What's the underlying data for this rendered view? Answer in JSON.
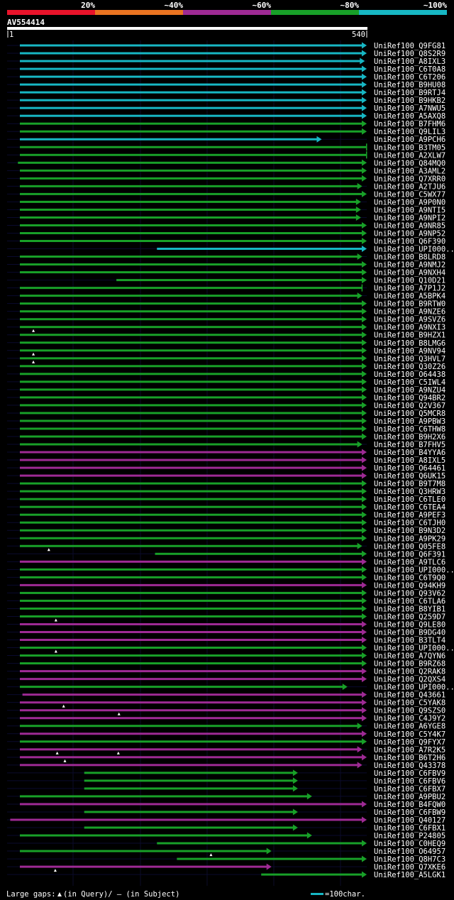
{
  "legend": {
    "p20": "20%",
    "p40": "~40%",
    "p60": "~60%",
    "p80": "~80%",
    "p100": "~100%",
    "colors": [
      "#e8132a",
      "#ea7421",
      "#9e2a94",
      "#18a028",
      "#17b7c4"
    ]
  },
  "query": {
    "name": "AV554414",
    "start": "1",
    "end": "540"
  },
  "footer": {
    "gaps_label": "Large gaps: ",
    "in_query": "(in Query)/",
    "dash": "—",
    "in_subject": " (in Subject)",
    "scale_label": "=100char."
  },
  "chart_data": {
    "type": "alignment",
    "query_length": 540,
    "color_map": {
      "c": "#17b7c4",
      "g": "#18a028",
      "m": "#9e2a94"
    },
    "hits": [
      {
        "name": "UniRef100_Q9FG81",
        "color": "c",
        "start": 1,
        "end": 540,
        "arrow": true
      },
      {
        "name": "UniRef100_Q8S2R9",
        "color": "c",
        "start": 1,
        "end": 540,
        "arrow": true
      },
      {
        "name": "UniRef100_A8IXL3",
        "color": "c",
        "start": 1,
        "end": 537,
        "arrow": true
      },
      {
        "name": "UniRef100_C6T0A8",
        "color": "c",
        "start": 1,
        "end": 540,
        "arrow": true
      },
      {
        "name": "UniRef100_C6T206",
        "color": "c",
        "start": 1,
        "end": 540,
        "arrow": true
      },
      {
        "name": "UniRef100_B9HU08",
        "color": "c",
        "start": 1,
        "end": 540,
        "arrow": true
      },
      {
        "name": "UniRef100_B9RTJ4",
        "color": "c",
        "start": 1,
        "end": 540,
        "arrow": true
      },
      {
        "name": "UniRef100_B9HKB2",
        "color": "c",
        "start": 1,
        "end": 540,
        "arrow": true
      },
      {
        "name": "UniRef100_A7NWU5",
        "color": "c",
        "start": 1,
        "end": 540,
        "arrow": true
      },
      {
        "name": "UniRef100_A5AXQ8",
        "color": "c",
        "start": 1,
        "end": 540,
        "arrow": true
      },
      {
        "name": "UniRef100_B7FHM6",
        "color": "g",
        "start": 1,
        "end": 540,
        "arrow": true
      },
      {
        "name": "UniRef100_Q9LIL3",
        "color": "g",
        "start": 1,
        "end": 540,
        "arrow": true
      },
      {
        "name": "UniRef100_A9PCH6",
        "color": "c",
        "start": 1,
        "end": 470,
        "arrow": true
      },
      {
        "name": "UniRef100_B3TM05",
        "color": "g",
        "start": 1,
        "end": 540,
        "arrow": false
      },
      {
        "name": "UniRef100_A2XLW7",
        "color": "g",
        "start": 1,
        "end": 540,
        "arrow": false
      },
      {
        "name": "UniRef100_Q84MQ0",
        "color": "g",
        "start": -2,
        "end": 540,
        "arrow": true
      },
      {
        "name": "UniRef100_A3AML2",
        "color": "g",
        "start": 1,
        "end": 540,
        "arrow": true
      },
      {
        "name": "UniRef100_Q7XRR0",
        "color": "g",
        "start": 1,
        "end": 540,
        "arrow": true
      },
      {
        "name": "UniRef100_A2TJU6",
        "color": "g",
        "start": 1,
        "end": 533,
        "arrow": true
      },
      {
        "name": "UniRef100_C5WX77",
        "color": "g",
        "start": 1,
        "end": 540,
        "arrow": true
      },
      {
        "name": "UniRef100_A9P0N0",
        "color": "g",
        "start": 1,
        "end": 531,
        "arrow": true
      },
      {
        "name": "UniRef100_A9NTI5",
        "color": "g",
        "start": 1,
        "end": 531,
        "arrow": true
      },
      {
        "name": "UniRef100_A9NPI2",
        "color": "g",
        "start": 1,
        "end": 531,
        "arrow": true
      },
      {
        "name": "UniRef100_A9NR85",
        "color": "g",
        "start": 1,
        "end": 540,
        "arrow": true
      },
      {
        "name": "UniRef100_A9NP52",
        "color": "g",
        "start": 1,
        "end": 540,
        "arrow": true
      },
      {
        "name": "UniRef100_Q6F390",
        "color": "g",
        "start": 1,
        "end": 540,
        "arrow": true
      },
      {
        "name": "UniRef100_UPI000..",
        "color": "c",
        "start": 214,
        "end": 540,
        "arrow": true
      },
      {
        "name": "UniRef100_B8LRD8",
        "color": "g",
        "start": 1,
        "end": 533,
        "arrow": true
      },
      {
        "name": "UniRef100_A9NMJ2",
        "color": "g",
        "start": 1,
        "end": 540,
        "arrow": true
      },
      {
        "name": "UniRef100_A9NXH4",
        "color": "g",
        "start": 1,
        "end": 540,
        "arrow": true
      },
      {
        "name": "UniRef100_Q10D21",
        "color": "g",
        "start": 151,
        "end": 540,
        "arrow": true
      },
      {
        "name": "UniRef100_A7P1J2",
        "color": "g",
        "start": 1,
        "end": 533,
        "arrow": false
      },
      {
        "name": "UniRef100_A5BPK4",
        "color": "g",
        "start": 1,
        "end": 533,
        "arrow": true
      },
      {
        "name": "UniRef100_B9RTW0",
        "color": "g",
        "start": 1,
        "end": 540,
        "arrow": true
      },
      {
        "name": "UniRef100_A9NZE6",
        "color": "g",
        "start": 1,
        "end": 540,
        "arrow": true
      },
      {
        "name": "UniRef100_A9SVZ6",
        "color": "g",
        "start": 1,
        "end": 540,
        "arrow": true
      },
      {
        "name": "UniRef100_A9NXI3",
        "color": "g",
        "start": 1,
        "end": 540,
        "arrow": true
      },
      {
        "name": "UniRef100_B9HZX1",
        "color": "g",
        "start": 1,
        "end": 540,
        "arrow": true
      },
      {
        "name": "UniRef100_B8LMG6",
        "color": "g",
        "start": 1,
        "end": 540,
        "arrow": true
      },
      {
        "name": "UniRef100_A9NV94",
        "color": "g",
        "start": 1,
        "end": 540,
        "arrow": true
      },
      {
        "name": "UniRef100_Q3HVL7",
        "color": "g",
        "start": 1,
        "end": 540,
        "arrow": true
      },
      {
        "name": "UniRef100_Q30Z26",
        "color": "g",
        "start": 1,
        "end": 540,
        "arrow": true
      },
      {
        "name": "UniRef100_O64438",
        "color": "g",
        "start": 1,
        "end": 540,
        "arrow": true
      },
      {
        "name": "UniRef100_C5IWL4",
        "color": "g",
        "start": 1,
        "end": 540,
        "arrow": true
      },
      {
        "name": "UniRef100_A9NZU4",
        "color": "g",
        "start": 1,
        "end": 540,
        "arrow": true
      },
      {
        "name": "UniRef100_Q94BR2",
        "color": "g",
        "start": 1,
        "end": 540,
        "arrow": true
      },
      {
        "name": "UniRef100_Q2V367",
        "color": "g",
        "start": 1,
        "end": 540,
        "arrow": true
      },
      {
        "name": "UniRef100_Q5MCR8",
        "color": "g",
        "start": 1,
        "end": 540,
        "arrow": true
      },
      {
        "name": "UniRef100_A9PBW3",
        "color": "g",
        "start": 1,
        "end": 540,
        "arrow": true
      },
      {
        "name": "UniRef100_C6THW8",
        "color": "g",
        "start": 1,
        "end": 540,
        "arrow": true
      },
      {
        "name": "UniRef100_B9H2X6",
        "color": "g",
        "start": 1,
        "end": 540,
        "arrow": true
      },
      {
        "name": "UniRef100_B7FHV5",
        "color": "g",
        "start": 1,
        "end": 533,
        "arrow": true
      },
      {
        "name": "UniRef100_B4YYA6",
        "color": "m",
        "start": 1,
        "end": 540,
        "arrow": true
      },
      {
        "name": "UniRef100_A8IXL5",
        "color": "m",
        "start": 1,
        "end": 540,
        "arrow": true
      },
      {
        "name": "UniRef100_O64461",
        "color": "m",
        "start": 1,
        "end": 540,
        "arrow": true
      },
      {
        "name": "UniRef100_Q6UK15",
        "color": "m",
        "start": 1,
        "end": 540,
        "arrow": true
      },
      {
        "name": "UniRef100_B9T7M8",
        "color": "g",
        "start": 1,
        "end": 540,
        "arrow": true
      },
      {
        "name": "UniRef100_Q3HRW3",
        "color": "g",
        "start": 1,
        "end": 540,
        "arrow": true
      },
      {
        "name": "UniRef100_C6TLE0",
        "color": "g",
        "start": 1,
        "end": 540,
        "arrow": true
      },
      {
        "name": "UniRef100_C6TEA4",
        "color": "g",
        "start": 1,
        "end": 540,
        "arrow": true
      },
      {
        "name": "UniRef100_A9PEF3",
        "color": "g",
        "start": 1,
        "end": 540,
        "arrow": true
      },
      {
        "name": "UniRef100_C6TJH0",
        "color": "g",
        "start": 1,
        "end": 540,
        "arrow": true
      },
      {
        "name": "UniRef100_B9N3D2",
        "color": "g",
        "start": 1,
        "end": 540,
        "arrow": true
      },
      {
        "name": "UniRef100_A9PK29",
        "color": "g",
        "start": 1,
        "end": 540,
        "arrow": true
      },
      {
        "name": "UniRef100_Q05FE8",
        "color": "g",
        "start": 1,
        "end": 533,
        "arrow": true
      },
      {
        "name": "UniRef100_Q6F391",
        "color": "g",
        "start": 211,
        "end": 540,
        "arrow": true
      },
      {
        "name": "UniRef100_A9TLC6",
        "color": "m",
        "start": 1,
        "end": 540,
        "arrow": true
      },
      {
        "name": "UniRef100_UPI000..",
        "color": "g",
        "start": 1,
        "end": 540,
        "arrow": true
      },
      {
        "name": "UniRef100_C6T9Q0",
        "color": "g",
        "start": 1,
        "end": 540,
        "arrow": true
      },
      {
        "name": "UniRef100_Q94KH9",
        "color": "m",
        "start": 1,
        "end": 540,
        "arrow": true
      },
      {
        "name": "UniRef100_Q93V62",
        "color": "g",
        "start": 1,
        "end": 540,
        "arrow": true
      },
      {
        "name": "UniRef100_C6TLA6",
        "color": "g",
        "start": 1,
        "end": 540,
        "arrow": true
      },
      {
        "name": "UniRef100_B8YIB1",
        "color": "g",
        "start": 1,
        "end": 540,
        "arrow": true
      },
      {
        "name": "UniRef100_Q259D7",
        "color": "g",
        "start": 1,
        "end": 540,
        "arrow": true
      },
      {
        "name": "UniRef100_Q9LE80",
        "color": "m",
        "start": 1,
        "end": 540,
        "arrow": true
      },
      {
        "name": "UniRef100_B9DG40",
        "color": "m",
        "start": 1,
        "end": 540,
        "arrow": true
      },
      {
        "name": "UniRef100_B3TLT4",
        "color": "m",
        "start": 1,
        "end": 540,
        "arrow": true
      },
      {
        "name": "UniRef100_UPI000..",
        "color": "g",
        "start": 1,
        "end": 540,
        "arrow": true
      },
      {
        "name": "UniRef100_A7QYN6",
        "color": "g",
        "start": 1,
        "end": 540,
        "arrow": true
      },
      {
        "name": "UniRef100_B9RZ68",
        "color": "g",
        "start": 1,
        "end": 540,
        "arrow": true
      },
      {
        "name": "UniRef100_Q2RAK8",
        "color": "m",
        "start": 1,
        "end": 540,
        "arrow": true
      },
      {
        "name": "UniRef100_Q2QXS4",
        "color": "m",
        "start": 1,
        "end": 540,
        "arrow": true
      },
      {
        "name": "UniRef100_UPI000..",
        "color": "g",
        "start": 1,
        "end": 510,
        "arrow": true
      },
      {
        "name": "UniRef100_Q43661",
        "color": "m",
        "start": 5,
        "end": 540,
        "arrow": true
      },
      {
        "name": "UniRef100_C5YAK8",
        "color": "m",
        "start": 1,
        "end": 540,
        "arrow": true
      },
      {
        "name": "UniRef100_Q9SZS0",
        "color": "m",
        "start": 1,
        "end": 540,
        "arrow": true
      },
      {
        "name": "UniRef100_C4J9Y2",
        "color": "m",
        "start": 1,
        "end": 540,
        "arrow": true
      },
      {
        "name": "UniRef100_A6YGE8",
        "color": "g",
        "start": 1,
        "end": 533,
        "arrow": true
      },
      {
        "name": "UniRef100_C5Y4K7",
        "color": "m",
        "start": 1,
        "end": 540,
        "arrow": true
      },
      {
        "name": "UniRef100_Q9FYX7",
        "color": "g",
        "start": 1,
        "end": 540,
        "arrow": true
      },
      {
        "name": "UniRef100_A7R2K5",
        "color": "m",
        "start": 1,
        "end": 533,
        "arrow": true
      },
      {
        "name": "UniRef100_B6T2H6",
        "color": "m",
        "start": 1,
        "end": 540,
        "arrow": true
      },
      {
        "name": "UniRef100_Q43378",
        "color": "m",
        "start": 1,
        "end": 533,
        "arrow": true
      },
      {
        "name": "UniRef100_C6FBV9",
        "color": "g",
        "start": 101,
        "end": 433,
        "arrow": true
      },
      {
        "name": "UniRef100_C6FBV6",
        "color": "g",
        "start": 101,
        "end": 433,
        "arrow": true
      },
      {
        "name": "UniRef100_C6FBX7",
        "color": "g",
        "start": 101,
        "end": 433,
        "arrow": true
      },
      {
        "name": "UniRef100_A9PBU2",
        "color": "g",
        "start": 1,
        "end": 455,
        "arrow": true
      },
      {
        "name": "UniRef100_B4FQW0",
        "color": "m",
        "start": 1,
        "end": 540,
        "arrow": true
      },
      {
        "name": "UniRef100_C6FBW9",
        "color": "g",
        "start": 101,
        "end": 433,
        "arrow": true
      },
      {
        "name": "UniRef100_Q40127",
        "color": "m",
        "start": -14,
        "end": 540,
        "arrow": true
      },
      {
        "name": "UniRef100_C6FBX1",
        "color": "g",
        "start": 101,
        "end": 433,
        "arrow": true
      },
      {
        "name": "UniRef100_P24805",
        "color": "g",
        "start": 1,
        "end": 455,
        "arrow": true
      },
      {
        "name": "UniRef100_C0HEQ9",
        "color": "g",
        "start": 214,
        "end": 540,
        "arrow": true
      },
      {
        "name": "UniRef100_O64957",
        "color": "g",
        "start": 1,
        "end": 392,
        "arrow": true
      },
      {
        "name": "UniRef100_Q8H7C3",
        "color": "g",
        "start": 245,
        "end": 540,
        "arrow": true
      },
      {
        "name": "UniRef100_Q7XKE6",
        "color": "m",
        "start": 1,
        "end": 392,
        "arrow": true
      },
      {
        "name": "UniRef100_A5LGK1",
        "color": "g",
        "start": 376,
        "end": 540,
        "arrow": true
      }
    ],
    "query_gaps": [
      {
        "row": 37,
        "pos": 22
      },
      {
        "row": 40,
        "pos": 22
      },
      {
        "row": 41,
        "pos": 22
      },
      {
        "row": 65,
        "pos": 46
      },
      {
        "row": 74,
        "pos": 57
      },
      {
        "row": 78,
        "pos": 57
      },
      {
        "row": 85,
        "pos": 69
      },
      {
        "row": 86,
        "pos": 155
      },
      {
        "row": 91,
        "pos": 59
      },
      {
        "row": 91,
        "pos": 154
      },
      {
        "row": 92,
        "pos": 71
      },
      {
        "row": 104,
        "pos": 298
      },
      {
        "row": 106,
        "pos": 56
      }
    ]
  }
}
